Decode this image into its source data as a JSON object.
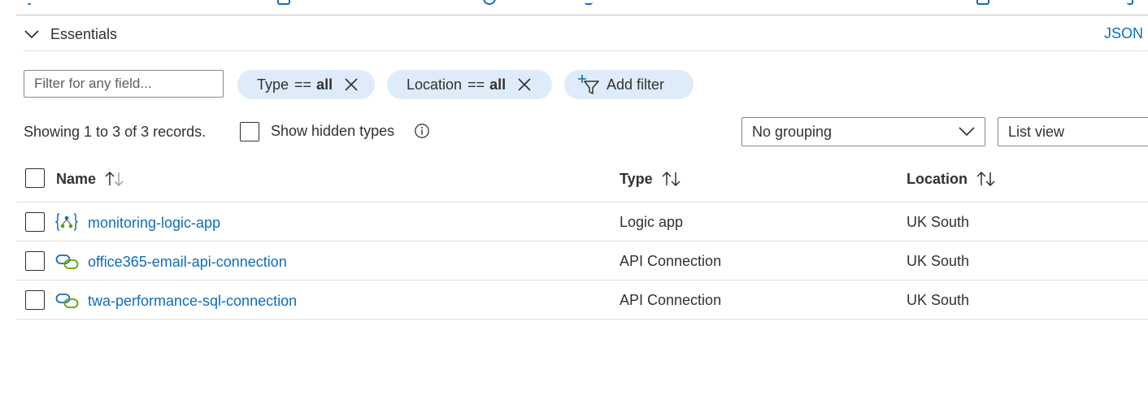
{
  "essentials": {
    "label": "Essentials",
    "json_link": "JSON"
  },
  "filters": {
    "placeholder": "Filter for any field...",
    "pills": [
      {
        "field": "Type",
        "operator": "==",
        "value": "all"
      },
      {
        "field": "Location",
        "operator": "==",
        "value": "all"
      }
    ],
    "add_filter": "Add filter"
  },
  "toolbar": {
    "showing": "Showing 1 to 3 of 3 records.",
    "show_hidden_types": "Show hidden types",
    "grouping": "No grouping",
    "view": "List view"
  },
  "table": {
    "columns": [
      "Name",
      "Type",
      "Location"
    ],
    "rows": [
      {
        "name": "monitoring-logic-app",
        "type": "Logic app",
        "location": "UK South",
        "icon": "logic-app-icon"
      },
      {
        "name": "office365-email-api-connection",
        "type": "API Connection",
        "location": "UK South",
        "icon": "api-connection-icon"
      },
      {
        "name": "twa-performance-sql-connection",
        "type": "API Connection",
        "location": "UK South",
        "icon": "api-connection-icon"
      }
    ]
  },
  "colors": {
    "link": "#0f6cbd",
    "pill_bg": "#deecf9",
    "text": "#323130",
    "border": "#8a8886"
  }
}
